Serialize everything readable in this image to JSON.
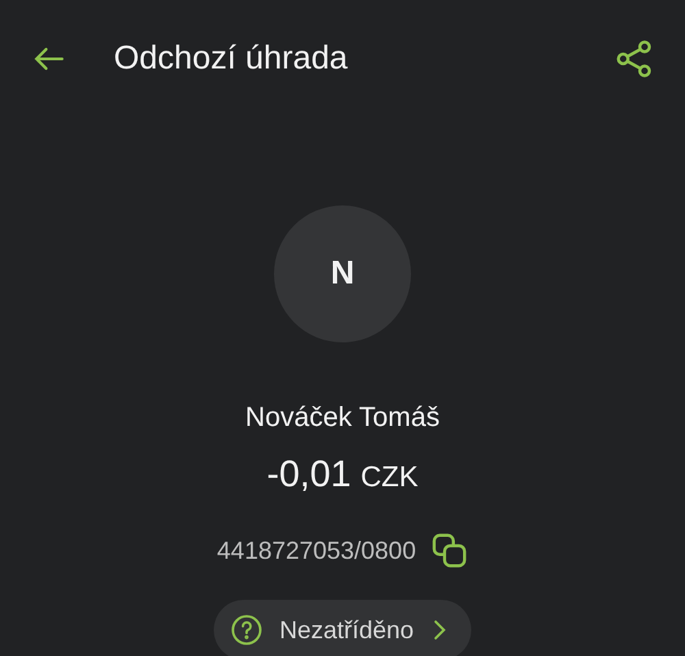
{
  "header": {
    "title": "Odchozí úhrada"
  },
  "counterparty": {
    "initial": "N",
    "name": "Nováček Tomáš"
  },
  "amount": {
    "value": "-0,01",
    "currency": "CZK"
  },
  "account": "4418727053/0800",
  "category": {
    "label": "Nezatříděno"
  }
}
